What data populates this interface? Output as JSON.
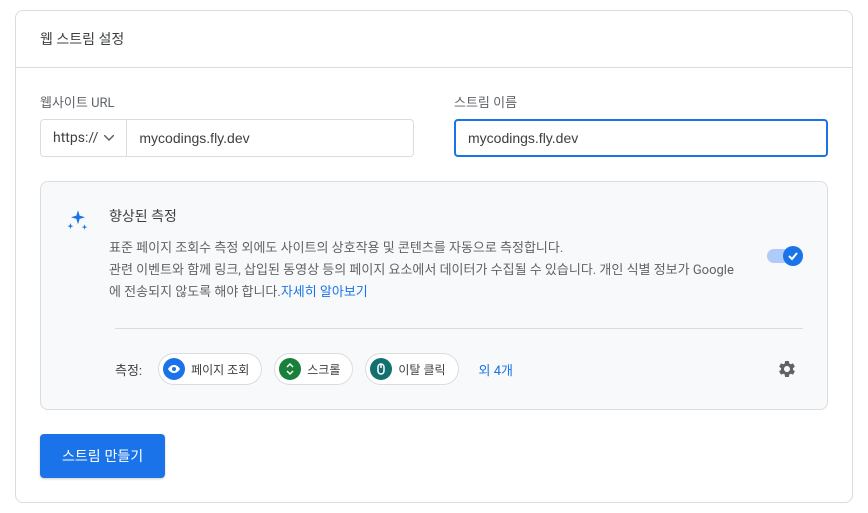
{
  "header": {
    "title": "웹 스트림 설정"
  },
  "form": {
    "url_label": "웹사이트 URL",
    "protocol": "https://",
    "url_value": "mycodings.fly.dev",
    "stream_name_label": "스트림 이름",
    "stream_name_value": "mycodings.fly.dev"
  },
  "enhanced_measurement": {
    "title": "향상된 측정",
    "description_line1": "표준 페이지 조회수 측정 외에도 사이트의 상호작용 및 콘텐츠를 자동으로 측정합니다.",
    "description_line2": "관련 이벤트와 함께 링크, 삽입된 동영상 등의 페이지 요소에서 데이터가 수집될 수 있습니다. 개인 식별 정보가 Google에 전송되지 않도록 해야 합니다.",
    "learn_more": "자세히 알아보기",
    "toggle_on": true
  },
  "measurement": {
    "label": "측정:",
    "chips": [
      {
        "label": "페이지 조회",
        "icon": "eye",
        "color": "blue"
      },
      {
        "label": "스크롤",
        "icon": "scroll",
        "color": "green"
      },
      {
        "label": "이탈 클릭",
        "icon": "mouse",
        "color": "teal"
      }
    ],
    "more_text": "외 4개"
  },
  "create_button_label": "스트림 만들기"
}
